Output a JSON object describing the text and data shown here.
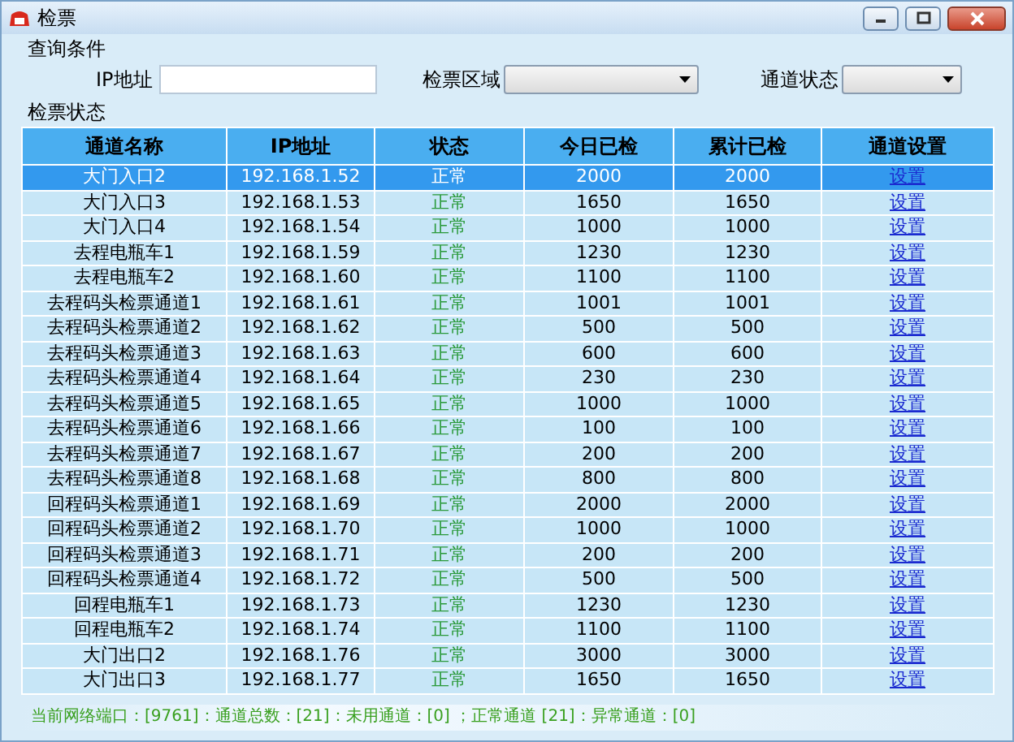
{
  "window": {
    "title": "检票"
  },
  "query": {
    "title": "查询条件",
    "ip_label": "IP地址",
    "area_label": "检票区域",
    "status_label": "通道状态"
  },
  "table": {
    "title": "检票状态",
    "columns": [
      "通道名称",
      "IP地址",
      "状态",
      "今日已检",
      "累计已检",
      "通道设置"
    ],
    "rows": [
      {
        "name": "大门入口2",
        "ip": "192.168.1.52",
        "status": "正常",
        "today": "2000",
        "total": "2000",
        "action": "设置",
        "selected": true
      },
      {
        "name": "大门入口3",
        "ip": "192.168.1.53",
        "status": "正常",
        "today": "1650",
        "total": "1650",
        "action": "设置",
        "selected": false
      },
      {
        "name": "大门入口4",
        "ip": "192.168.1.54",
        "status": "正常",
        "today": "1000",
        "total": "1000",
        "action": "设置",
        "selected": false
      },
      {
        "name": "去程电瓶车1",
        "ip": "192.168.1.59",
        "status": "正常",
        "today": "1230",
        "total": "1230",
        "action": "设置",
        "selected": false
      },
      {
        "name": "去程电瓶车2",
        "ip": "192.168.1.60",
        "status": "正常",
        "today": "1100",
        "total": "1100",
        "action": "设置",
        "selected": false
      },
      {
        "name": "去程码头检票通道1",
        "ip": "192.168.1.61",
        "status": "正常",
        "today": "1001",
        "total": "1001",
        "action": "设置",
        "selected": false
      },
      {
        "name": "去程码头检票通道2",
        "ip": "192.168.1.62",
        "status": "正常",
        "today": "500",
        "total": "500",
        "action": "设置",
        "selected": false
      },
      {
        "name": "去程码头检票通道3",
        "ip": "192.168.1.63",
        "status": "正常",
        "today": "600",
        "total": "600",
        "action": "设置",
        "selected": false
      },
      {
        "name": "去程码头检票通道4",
        "ip": "192.168.1.64",
        "status": "正常",
        "today": "230",
        "total": "230",
        "action": "设置",
        "selected": false
      },
      {
        "name": "去程码头检票通道5",
        "ip": "192.168.1.65",
        "status": "正常",
        "today": "1000",
        "total": "1000",
        "action": "设置",
        "selected": false
      },
      {
        "name": "去程码头检票通道6",
        "ip": "192.168.1.66",
        "status": "正常",
        "today": "100",
        "total": "100",
        "action": "设置",
        "selected": false
      },
      {
        "name": "去程码头检票通道7",
        "ip": "192.168.1.67",
        "status": "正常",
        "today": "200",
        "total": "200",
        "action": "设置",
        "selected": false
      },
      {
        "name": "去程码头检票通道8",
        "ip": "192.168.1.68",
        "status": "正常",
        "today": "800",
        "total": "800",
        "action": "设置",
        "selected": false
      },
      {
        "name": "回程码头检票通道1",
        "ip": "192.168.1.69",
        "status": "正常",
        "today": "2000",
        "total": "2000",
        "action": "设置",
        "selected": false
      },
      {
        "name": "回程码头检票通道2",
        "ip": "192.168.1.70",
        "status": "正常",
        "today": "1000",
        "total": "1000",
        "action": "设置",
        "selected": false
      },
      {
        "name": "回程码头检票通道3",
        "ip": "192.168.1.71",
        "status": "正常",
        "today": "200",
        "total": "200",
        "action": "设置",
        "selected": false
      },
      {
        "name": "回程码头检票通道4",
        "ip": "192.168.1.72",
        "status": "正常",
        "today": "500",
        "total": "500",
        "action": "设置",
        "selected": false
      },
      {
        "name": "回程电瓶车1",
        "ip": "192.168.1.73",
        "status": "正常",
        "today": "1230",
        "total": "1230",
        "action": "设置",
        "selected": false
      },
      {
        "name": "回程电瓶车2",
        "ip": "192.168.1.74",
        "status": "正常",
        "today": "1100",
        "total": "1100",
        "action": "设置",
        "selected": false
      },
      {
        "name": "大门出口2",
        "ip": "192.168.1.76",
        "status": "正常",
        "today": "3000",
        "total": "3000",
        "action": "设置",
        "selected": false
      },
      {
        "name": "大门出口3",
        "ip": "192.168.1.77",
        "status": "正常",
        "today": "1650",
        "total": "1650",
        "action": "设置",
        "selected": false
      }
    ]
  },
  "status_bar": "当前网络端口：[9761]：通道总数：[21]：未用通道：[0] ；正常通道 [21]：异常通道：[0]"
}
